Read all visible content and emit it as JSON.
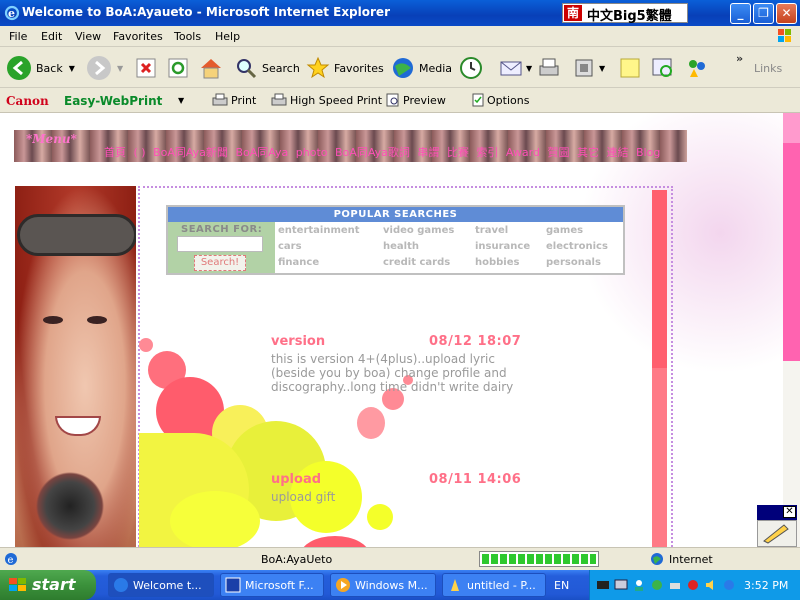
{
  "window": {
    "title": "Welcome to BoA:Ayaueto - Microsoft Internet Explorer",
    "big5_label": "中文Big5繁體",
    "big5_icon": "南"
  },
  "menubar": {
    "items": [
      "File",
      "Edit",
      "View",
      "Favorites",
      "Tools",
      "Help"
    ]
  },
  "toolbar": {
    "back": "Back",
    "search": "Search",
    "favorites": "Favorites",
    "media": "Media",
    "links": "Links",
    "more": "»"
  },
  "canonbar": {
    "brand": "Canon",
    "product": "Easy-WebPrint",
    "print": "Print",
    "hsprint": "High Speed Print",
    "preview": "Preview",
    "options": "Options"
  },
  "page": {
    "menu_tag": "*Menu*",
    "nav": [
      "首頁",
      "( )",
      "BoA同Aya新聞",
      "BoA同Aya",
      "photo",
      "BoA同Aya歌詞",
      "串謂",
      "比賽",
      "索引",
      "Award",
      "賀圖",
      "其它",
      "連結",
      "Blog"
    ],
    "search": {
      "header": "POPULAR SEARCHES",
      "label": "SEARCH FOR:",
      "input_value": "",
      "button": "Search!",
      "keywords": [
        [
          "entertainment",
          "video games",
          "travel",
          "games"
        ],
        [
          "cars",
          "health",
          "insurance",
          "electronics"
        ],
        [
          "finance",
          "credit cards",
          "hobbies",
          "personals"
        ]
      ]
    },
    "posts": [
      {
        "title": "version",
        "date": "08/12 18:07",
        "body": "this is version 4+(4plus)..upload lyric (beside you by boa) change profile and discography..long time didn't write dairy"
      },
      {
        "title": "upload",
        "date": "08/11 14:06",
        "body": "upload gift"
      }
    ]
  },
  "statusbar": {
    "text": "BoA:AyaUeto",
    "zone": "Internet",
    "progress": 1.0
  },
  "taskbar": {
    "start": "start",
    "tasks": [
      "Welcome t...",
      "Microsoft F...",
      "Windows M...",
      "untitled - P..."
    ],
    "lang": "EN",
    "clock": "3:52 PM"
  },
  "colors": {
    "accent_pink": "#ff7088",
    "title_blue": "#0a4ac6",
    "start_green": "#3b913b"
  }
}
